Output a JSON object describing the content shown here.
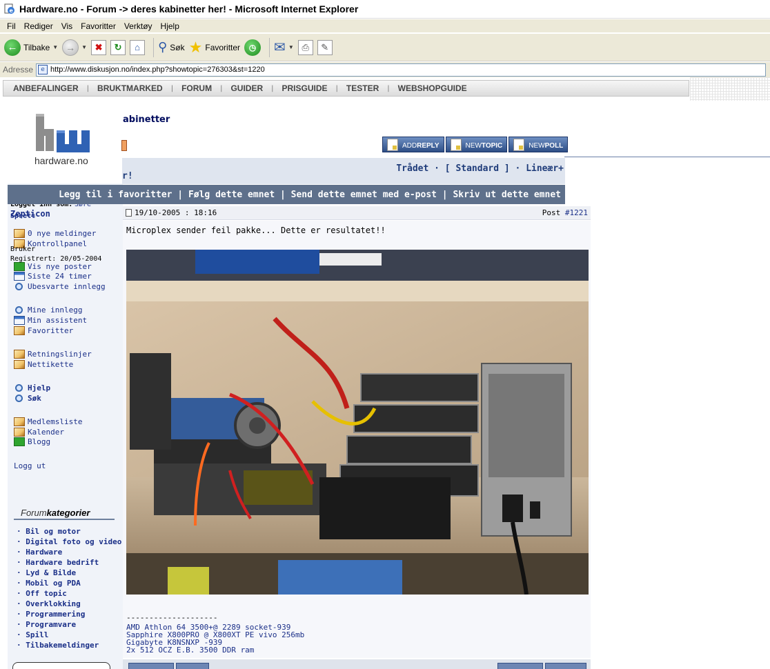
{
  "window": {
    "title": "Hardware.no - Forum -> deres kabinetter her! - Microsoft Internet Explorer"
  },
  "menu": [
    "Fil",
    "Rediger",
    "Vis",
    "Favoritter",
    "Verktøy",
    "Hjelp"
  ],
  "toolbar": {
    "back_label": "Tilbake",
    "search_label": "Søk",
    "favorites_label": "Favoritter"
  },
  "address": {
    "label": "Adresse",
    "url": "http://www.diskusjon.no/index.php?showtopic=276303&st=1220"
  },
  "site_nav": [
    "ANBEFALINGER",
    "BRUKTMARKED",
    "FORUM",
    "GUIDER",
    "PRISGUIDE",
    "TESTER",
    "WEBSHOPGUIDE"
  ],
  "logo": {
    "text": "hardware.no"
  },
  "topic": {
    "title_fragment": "abinetter",
    "buttons": [
      {
        "pre": "ADD",
        "post": "REPLY"
      },
      {
        "pre": "NEW",
        "post": "TOPIC"
      },
      {
        "pre": "NEW",
        "post": "POLL"
      }
    ],
    "view_modes": "Trådet · [ Standard ] · Lineær+",
    "title_fragment_2": "r!"
  },
  "topic_options": "Legg til i favoritter | Følg dette emnet | Send dette emnet med e-post | Skriv ut dette emnet",
  "sidebar": {
    "logged_in_as_label": "Logget inn som:",
    "username": "Zepticon",
    "overlap_fragment_1": "Søre",
    "overlap_fragment_2": "Sprett",
    "user_group": "Bruker",
    "registered": "Registrert: 20/05-2004",
    "links": [
      {
        "label": "0 nye meldinger",
        "icon": "note"
      },
      {
        "label": "Kontrollpanel",
        "icon": "note"
      },
      {
        "label": "Vis nye poster",
        "icon": "mail"
      },
      {
        "label": "Siste 24 timer",
        "icon": "win"
      },
      {
        "label": "Ubesvarte innlegg",
        "icon": "mag"
      },
      {
        "label": "Mine innlegg",
        "icon": "mag"
      },
      {
        "label": "Min assistent",
        "icon": "win"
      },
      {
        "label": "Favoritter",
        "icon": "note"
      },
      {
        "label": "Retningslinjer",
        "icon": "note"
      },
      {
        "label": "Nettikette",
        "icon": "note"
      },
      {
        "label": "Hjelp",
        "icon": "mag"
      },
      {
        "label": "Søk",
        "icon": "mag"
      },
      {
        "label": "Medlemsliste",
        "icon": "note"
      },
      {
        "label": "Kalender",
        "icon": "note"
      },
      {
        "label": "Blogg",
        "icon": "mail"
      }
    ],
    "logout": "Logg ut",
    "categories_title_pre": "Forum",
    "categories_title_post": "kategorier",
    "categories": [
      "· Bil og motor",
      "· Digital foto og video",
      "· Hardware",
      "· Hardware bedrift",
      "· Lyd & Bilde",
      "· Mobil og PDA",
      "· Off topic",
      "· Overklokking",
      "· Programmering",
      "· Programvare",
      "· Spill",
      "· Tilbakemeldinger"
    ]
  },
  "post": {
    "date": "19/10-2005 : 18:16",
    "post_label": "Post",
    "post_number": "#1221",
    "message": "Microplex sender feil pakke... Dette er resultatet!!",
    "signature_rule": "--------------------",
    "signature": [
      "AMD Athlon 64 3500+@ 2289 socket-939",
      "Sapphire X800PRO @ X800XT PE vivo 256mb",
      "Gigabyte K8NSNXP -939",
      "2x 512 OCZ E.B. 3500 DDR ram"
    ]
  }
}
